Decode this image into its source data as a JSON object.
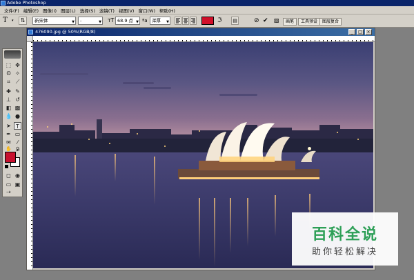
{
  "app": {
    "title": "Adobe Photoshop"
  },
  "menu": [
    "文件(F)",
    "编辑(E)",
    "图像(I)",
    "图层(L)",
    "选择(S)",
    "滤镜(T)",
    "视图(V)",
    "窗口(W)",
    "帮助(H)"
  ],
  "options": {
    "tool_glyph": "T",
    "font_family": "新宋体",
    "font_style": "-",
    "font_size": "68.9 点",
    "antialias": "浑厚",
    "text_color": "#d0102a",
    "palette_tabs": [
      "画笔",
      "工具预设",
      "图层复合"
    ]
  },
  "document": {
    "title": "476090.jpg @ 50%(RGB/8)"
  },
  "tools": {
    "fg_color": "#c8102e",
    "bg_color": "#ffffff"
  },
  "watermark": {
    "title": "百科全说",
    "subtitle": "助你轻松解决"
  },
  "icons": {
    "window_min": "minimize-icon",
    "window_max": "maximize-icon",
    "window_close": "close-icon"
  }
}
